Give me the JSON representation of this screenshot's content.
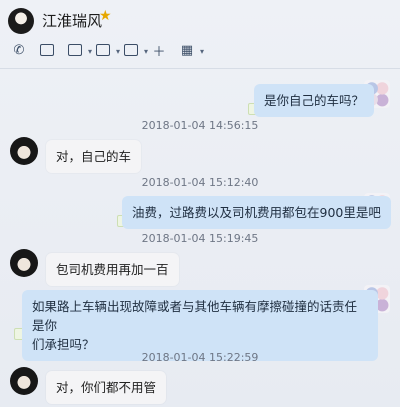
{
  "header": {
    "contact_name": "江淮瑞风",
    "star_glyph": "★"
  },
  "toolbar": {
    "phone_glyph": "✆",
    "video_glyph": "▭",
    "screen_glyph": "▭",
    "share_glyph": "▭",
    "remote_glyph": "▭",
    "add_glyph": "＋",
    "apps_glyph": "▦"
  },
  "messages": [
    {
      "side": "right",
      "text": "是你自己的车吗？"
    },
    {
      "side": "time",
      "text": "2018-01-04 14:56:15"
    },
    {
      "side": "left",
      "text": "对，自己的车"
    },
    {
      "side": "time",
      "text": "2018-01-04 15:12:40"
    },
    {
      "side": "right",
      "text": "油费，过路费以及司机费用都包在900里是吧"
    },
    {
      "side": "time",
      "text": "2018-01-04 15:19:45"
    },
    {
      "side": "left",
      "text": "包司机费用再加一百"
    },
    {
      "side": "right",
      "line1": "如果路上车辆出现故障或者与其他车辆有摩擦碰撞的话责任是你",
      "line2": "们承担吗？"
    },
    {
      "side": "time",
      "text": "2018-01-04 15:22:59"
    },
    {
      "side": "left",
      "text": "对，你们都不用管"
    }
  ],
  "colors": {
    "background": "#eaedf3",
    "bubble_self": "#cfe3f7",
    "bubble_other": "#f4f4f6",
    "timestamp": "#6e7685",
    "star": "#e6a700"
  }
}
